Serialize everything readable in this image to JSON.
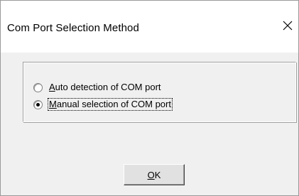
{
  "window": {
    "title": "Com Port Selection Method",
    "close_icon": "close-icon"
  },
  "options": [
    {
      "accel": "A",
      "rest": "uto detection of COM port",
      "checked": false
    },
    {
      "accel": "M",
      "rest": "anual selection of COM port",
      "checked": true
    }
  ],
  "ok_button": {
    "accel": "O",
    "rest": "K"
  }
}
